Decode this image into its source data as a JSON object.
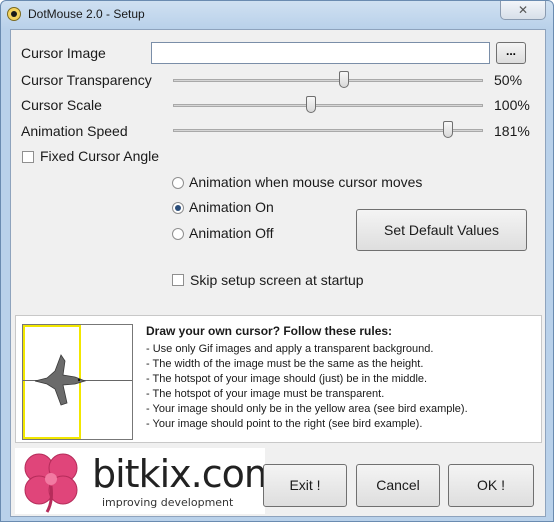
{
  "window": {
    "title": "DotMouse 2.0 - Setup",
    "close_glyph": "✕"
  },
  "fields": {
    "cursor_image_label": "Cursor Image",
    "cursor_image_value": "",
    "browse_label": "...",
    "transparency_label": "Cursor Transparency",
    "transparency_value": "50%",
    "transparency_level": 50,
    "scale_label": "Cursor Scale",
    "scale_value": "100%",
    "scale_level": 100,
    "speed_label": "Animation Speed",
    "speed_value": "181%",
    "speed_level": 181,
    "fixed_angle_label": "Fixed Cursor Angle",
    "fixed_angle_checked": false
  },
  "animation": {
    "options": [
      {
        "label": "Animation when mouse cursor moves",
        "selected": false
      },
      {
        "label": "Animation On",
        "selected": true
      },
      {
        "label": "Animation Off",
        "selected": false
      }
    ],
    "set_default_label": "Set Default Values",
    "skip_setup_label": "Skip setup screen at startup",
    "skip_setup_checked": false
  },
  "rules": {
    "title": "Draw your own cursor? Follow these rules:",
    "items": [
      "- Use only Gif images and apply a transparent background.",
      "- The width of the image must be the same as the height.",
      "- The hotspot of your image should (just) be in the middle.",
      "- The hotspot of your image must be transparent.",
      "- Your image should only be in the yellow area (see bird example).",
      "- Your image should point to the right (see bird example)."
    ]
  },
  "logo": {
    "name": "bitkix.com",
    "tagline": "improving development"
  },
  "buttons": {
    "exit": "Exit !",
    "cancel": "Cancel",
    "ok": "OK !"
  },
  "colors": {
    "titlebar": "#b9d1ea",
    "client_bg": "#f0f0f0",
    "example_yellow": "#f2e700",
    "logo_pink": "#e0457a"
  }
}
